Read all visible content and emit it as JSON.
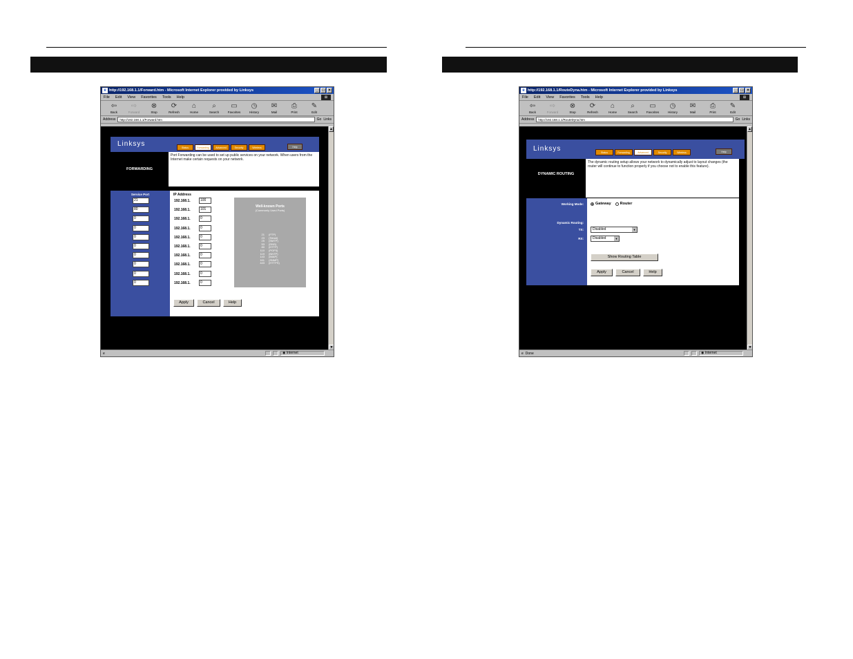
{
  "left": {
    "browser": {
      "title": "http://192.168.1.1/Forward.htm - Microsoft Internet Explorer provided by Linksys",
      "address_label": "Address",
      "url": "http://192.168.1.1/Forward.htm",
      "go": "Go",
      "links": "Links"
    },
    "router": {
      "logo": "Linksys",
      "tabs": [
        "Status",
        "Forwarding",
        "Advanced",
        "Security",
        "Wireless"
      ],
      "active_tab": 1,
      "help_tab": "Help",
      "section_title": "FORWARDING",
      "description": "Port Forwarding can be used to set up public services on your network. When users from the Internet make certain requests on your network.",
      "service_port_header": "Service Port",
      "ip_header": "IP Address",
      "ip_prefix": "192.168.1.",
      "ports": [
        "21",
        "80",
        "0",
        "0",
        "0",
        "0",
        "0",
        "0",
        "0",
        "0"
      ],
      "ips": [
        "100",
        "101",
        "0",
        "0",
        "0",
        "0",
        "0",
        "0",
        "0",
        "0"
      ],
      "well_known_title": "Well-known Ports",
      "well_known_subtitle": "(Commonly Used Ports)",
      "well_known_ports": [
        "21",
        "23",
        "25",
        "53",
        "80",
        "110",
        "119",
        "143",
        "161",
        "443"
      ],
      "well_known_names": [
        "(FTP)",
        "(Telnet)",
        "(SMTP)",
        "(DNS)",
        "(HTTP)",
        "(POP3)",
        "(NNTP)",
        "(IMAP)",
        "(SNMP)",
        "(HTTPS)"
      ],
      "apply": "Apply",
      "cancel": "Cancel",
      "help": "Help"
    }
  },
  "right": {
    "browser": {
      "title": "http://192.168.1.1/RouteDyna.htm - Microsoft Internet Explorer provided by Linksys",
      "address_label": "Address",
      "url": "http://192.168.1.1/RouteDyna.htm",
      "go": "Go",
      "links": "Links",
      "status": "Done"
    },
    "router": {
      "logo": "Linksys",
      "tabs": [
        "Status",
        "Forwarding",
        "Advanced",
        "Security",
        "Wireless"
      ],
      "active_tab": 2,
      "help_tab": "Help",
      "section_title": "DYNAMIC ROUTING",
      "description": "The dynamic routing setup allows your network to dynamically adjust to layout changes (the router will continue to function properly if you choose not to enable this feature).",
      "working_mode_label": "Working Mode:",
      "gateway": "Gateway",
      "router_opt": "Router",
      "dynamic_routing_label": "Dynamic Routing:",
      "tx_label": "TX:",
      "rx_label": "RX:",
      "tx_value": "Disabled",
      "rx_value": "Disabled",
      "show_table": "Show Routing Table",
      "apply": "Apply",
      "cancel": "Cancel",
      "help": "Help"
    }
  },
  "common": {
    "menu": [
      "File",
      "Edit",
      "View",
      "Favorites",
      "Tools",
      "Help"
    ],
    "toolbar": [
      "Back",
      "Forward",
      "Stop",
      "Refresh",
      "Home",
      "Search",
      "Favorites",
      "History",
      "Mail",
      "Print",
      "Edit"
    ],
    "status_zone": "Internet"
  }
}
